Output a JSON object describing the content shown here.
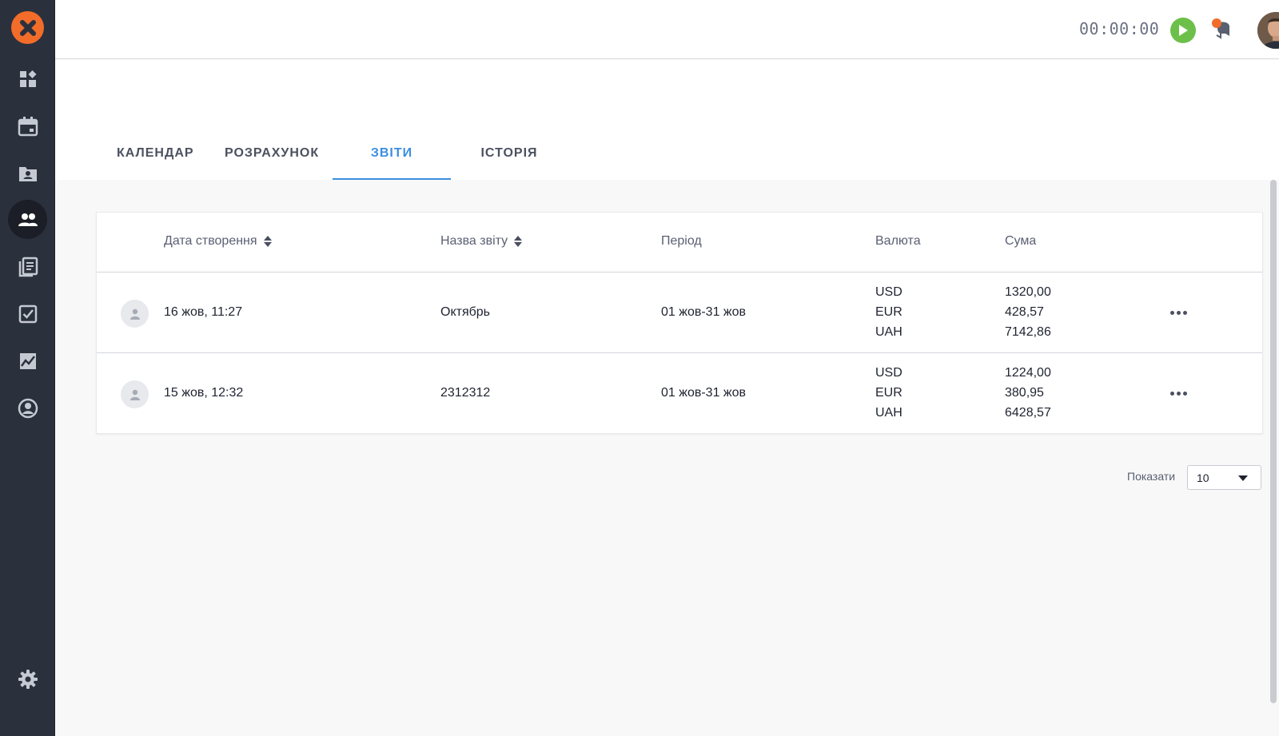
{
  "header": {
    "timer": "00:00:00"
  },
  "tabs": [
    {
      "label": "КАЛЕНДАР"
    },
    {
      "label": "РОЗРАХУНОК"
    },
    {
      "label": "ЗВІТИ"
    },
    {
      "label": "ІСТОРІЯ"
    }
  ],
  "active_tab": "ЗВІТИ",
  "table": {
    "columns": {
      "created": "Дата створення",
      "name": "Назва звіту",
      "period": "Період",
      "currency": "Валюта",
      "amount": "Сума"
    },
    "rows": [
      {
        "created": "16 жов, 11:27",
        "name": "Октябрь",
        "period": "01 жов-31 жов",
        "currencies": [
          "USD",
          "EUR",
          "UAH"
        ],
        "amounts": [
          "1320,00",
          "428,57",
          "7142,86"
        ]
      },
      {
        "created": "15 жов, 12:32",
        "name": "2312312",
        "period": "01 жов-31 жов",
        "currencies": [
          "USD",
          "EUR",
          "UAH"
        ],
        "amounts": [
          "1224,00",
          "380,95",
          "6428,57"
        ]
      }
    ]
  },
  "pagination": {
    "show_label": "Показати",
    "page_size": "10"
  },
  "colors": {
    "sidebar": "#2b303d",
    "accent": "#3a8ee0",
    "logo": "#f26c2a",
    "play": "#6cc04a"
  },
  "icons": {
    "sidebar": [
      "dashboard-icon",
      "calendar-icon",
      "contacts-folder-icon",
      "team-icon",
      "library-icon",
      "tasks-icon",
      "reports-chart-icon",
      "profile-icon",
      "settings-icon"
    ],
    "header": [
      "play-icon",
      "chat-icon",
      "caret-down-icon"
    ]
  }
}
